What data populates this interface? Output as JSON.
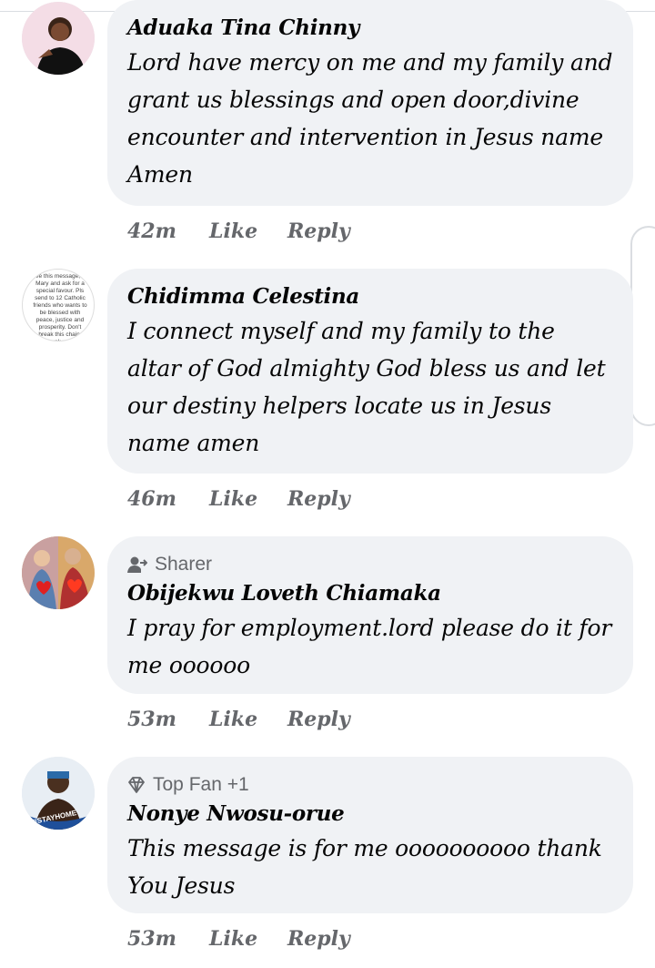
{
  "comments": [
    {
      "avatar_icon": "user-photo-woman-pink-background",
      "badge": "",
      "name": "Aduaka Tina Chinny",
      "text": "Lord have mercy on me and my family and grant us blessings and open door,divine encounter and intervention in Jesus name Amen",
      "time": "42m",
      "like": "Like",
      "reply": "Reply"
    },
    {
      "avatar_icon": "prayer-text-image",
      "avatar_text": "ove this message, all Mary and ask for a special favour. Pls send to 12 Catholic friends who wants to be blessed with peace, justice and prosperity. Don't break this chain, thank you.",
      "badge": "",
      "name": "Chidimma Celestina",
      "text": "I connect myself and my family to the altar of God almighty God bless us and let our destiny helpers locate us in Jesus name amen",
      "time": "46m",
      "like": "Like",
      "reply": "Reply"
    },
    {
      "avatar_icon": "sacred-hearts-image",
      "badge": "Sharer",
      "badge_icon": "sharer-icon",
      "name": "Obijekwu Loveth Chiamaka",
      "text": "I pray for employment.lord please do it for me oooooo",
      "time": "53m",
      "like": "Like",
      "reply": "Reply"
    },
    {
      "avatar_icon": "user-photo-stayhome-frame",
      "avatar_text": "#STAYHOME",
      "badge": "Top Fan +1",
      "badge_icon": "diamond-icon",
      "name": "Nonye Nwosu-orue",
      "text": "This message is for me oooooooooo thank You Jesus",
      "time": "53m",
      "like": "Like",
      "reply": "Reply"
    }
  ],
  "colors": {
    "bubble": "#f0f2f5",
    "meta": "#65676b",
    "text": "#050505"
  }
}
